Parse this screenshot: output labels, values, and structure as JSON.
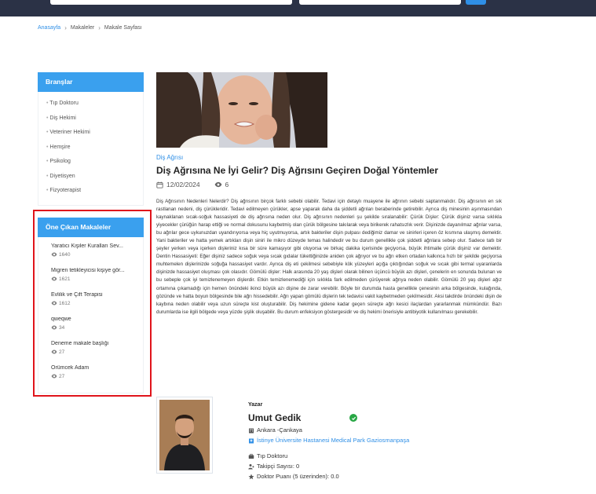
{
  "breadcrumb": {
    "home": "Anasayfa",
    "articles": "Makaleler",
    "current": "Makale Sayfası"
  },
  "branches": {
    "title": "Branşlar",
    "items": [
      "Tıp Doktoru",
      "Diş Hekimi",
      "Veteriner Hekimi",
      "Hemşire",
      "Psikolog",
      "Diyetisyen",
      "Fizyoterapist"
    ]
  },
  "featured": {
    "title": "Öne Çıkan Makaleler",
    "items": [
      {
        "title": "Yaratıcı Kişiler Kuralları Sev...",
        "views": "1640"
      },
      {
        "title": "Migren tetikleyicisi kişiye gör...",
        "views": "1621"
      },
      {
        "title": "Evlilik ve Çift Terapisi",
        "views": "1612"
      },
      {
        "title": "qweqwe",
        "views": "34"
      },
      {
        "title": "Deneme makale başlığı",
        "views": "27"
      },
      {
        "title": "Örümcek Adam",
        "views": "27"
      }
    ]
  },
  "article": {
    "category": "Diş Ağrısı",
    "title": "Diş Ağrısına Ne İyi Gelir? Diş Ağrısını Geçiren Doğal Yöntemler",
    "date": "12/02/2024",
    "views": "6",
    "body": "Diş Ağrısının Nedenleri Nelerdir? Diş ağrısının birçok farklı sebebi olabilir. Tedavi için detaylı muayene ile ağrının sebebi saptanmalıdır. Diş ağrısının en sık rastlanan nedeni, diş çürükleridir. Tedavi edilmeyen çürükler, apse yaparak daha da şiddetli ağrıları beraberinde getirebilir. Ayrıca diş minesinin aşınmasından kaynaklanan sıcak-soğuk hassasiyeti de diş ağrısına neden olur. Diş ağrısının nedenleri şu şekilde sıralanabilir: Çürük Dişler: Çürük dişiniz varsa sıklıkla yiyecekler çürüğün harap ettiği ve normal dokusunu kaybetmiş olan çürük bölgesine takılarak veya birikerek rahatsızlık verir. Dişinizde dayanılmaz ağrılar varsa, bu ağrılar gece uykunuzdan uyandırıyorsa veya hiç uyutmuyorsa, artık bakteriler dişin pulpası dediğimiz damar ve sinirleri içeren öz kısmına ulaşmış demektir. Yani bakteriler ve hatta yemek artıkları dişin siniri ile mikro düzeyde temas halindedir ve bu durum genellikle çok şiddetli ağrılara sebep olur. Sadece tatlı bir şeyler yerken veya içerken dişleriniz kısa bir süre kamaşıyor gibi oluyorsa ve birkaç dakika içerisinde geçiyorsa, büyük ihtimalle çürük dişiniz var demektir. Dentin Hassasiyeti: Eğer dişiniz sadece soğuk veya sıcak gıdalar tükettiğinizde aniden çok ağrıyor ve bu ağrı etken ortadan kalkınca hızlı bir şekilde geçiyorsa muhtemelen dişlerinizde soğuğa hassasiyet vardır. Ayrıca diş eti çekilmesi sebebiyle kök yüzeyleri açığa çıktığından soğuk ve sıcak gibi termal uyaranlarda dişinizde hassasiyet oluşması çok olasıdır. Gömülü dişler: Halk arasında 20 yaş dişleri olarak bilinen üçüncü büyük azı dişleri, çenelerin en sonunda bulunan ve bu sebeple çok iyi temizlenemeyen dişlerdir. Etkin temizlenemediği için sıklıkla fark edilmeden çürüyerek ağrıya neden olabilir. Gömülü 20 yaş dişleri ağız ortamına çıkamadığı için hemen önündeki ikinci büyük azı dişine de zarar verebilir. Böyle bir durumda hasta genellikle çenesinin arka bölgesinde, kulağında, gözünde ve hatta boyun bölgesinde bile ağrı hissedebilir. Ağrı yapan gömülü dişlerin tek tedavisi vakit kaybetmeden çekilmesidir. Aksi takdirde önündeki dişin de kaybına neden olabilir veya uzun süreçte kist oluşturabilir. Diş hekimine gidene kadar geçen süreçte ağrı kesici ilaçlardan yararlanmak mümkündür. Bazı durumlarda ise ilgili bölgede veya yüzde şişlik oluşabilir. Bu durum enfeksiyon göstergesidir ve diş hekimi önerisiyle antibiyotik kullanılması gerekebilir."
  },
  "author": {
    "label": "Yazar",
    "name": "Umut Gedik",
    "location": "Ankara -Çankaya",
    "hospital": "İstinye Üniversite Hastanesi Medical Park Gaziosmanpaşa",
    "branch": "Tıp Doktoru",
    "followers": "Takipçi Sayısı: 0",
    "rating": "Doktor Puanı (5 üzerinden): 0.0"
  },
  "icons": {
    "breadcrumb_sep": "chevron-right-icon",
    "date": "calendar-icon",
    "views": "eye-icon",
    "verified": "check-circle-icon",
    "location": "building-icon",
    "hospital": "hospital-icon",
    "branch": "briefcase-icon",
    "followers": "user-plus-icon",
    "rating": "star-icon"
  },
  "colors": {
    "accent": "#3aa0ee",
    "header": "#2b3246",
    "highlight": "#e0141b",
    "verified": "#28a745"
  }
}
